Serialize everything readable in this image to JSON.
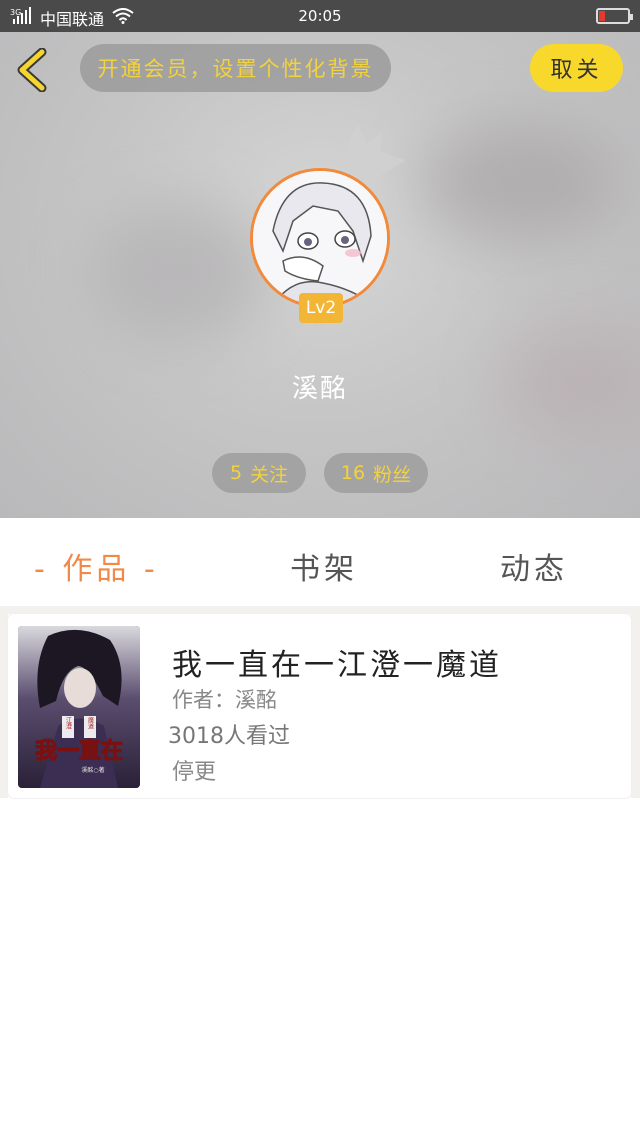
{
  "status_bar": {
    "carrier": "中国联通",
    "network": "3G",
    "time": "20:05"
  },
  "header": {
    "member_prompt": "开通会员，设置个性化背景",
    "cancel_follow": "取关"
  },
  "profile": {
    "level": "Lv2",
    "username": "溪酩",
    "follow_count": "5",
    "follow_label": "关注",
    "fans_count": "16",
    "fans_label": "粉丝"
  },
  "tabs": [
    {
      "label": "- 作品 -"
    },
    {
      "label": "书架"
    },
    {
      "label": "动态"
    }
  ],
  "works": [
    {
      "title": "我一直在一江澄一魔道",
      "author": "作者：溪酩",
      "views": "3018人看过",
      "status": "停更",
      "cover_text": "我一直在",
      "cover_tag_left": "江澄",
      "cover_tag_right": "魔道",
      "cover_author": "溪酩○著"
    }
  ],
  "colors": {
    "accent_orange": "#ef8a4a",
    "accent_yellow": "#f8d92b",
    "level_badge": "#f3b535"
  }
}
